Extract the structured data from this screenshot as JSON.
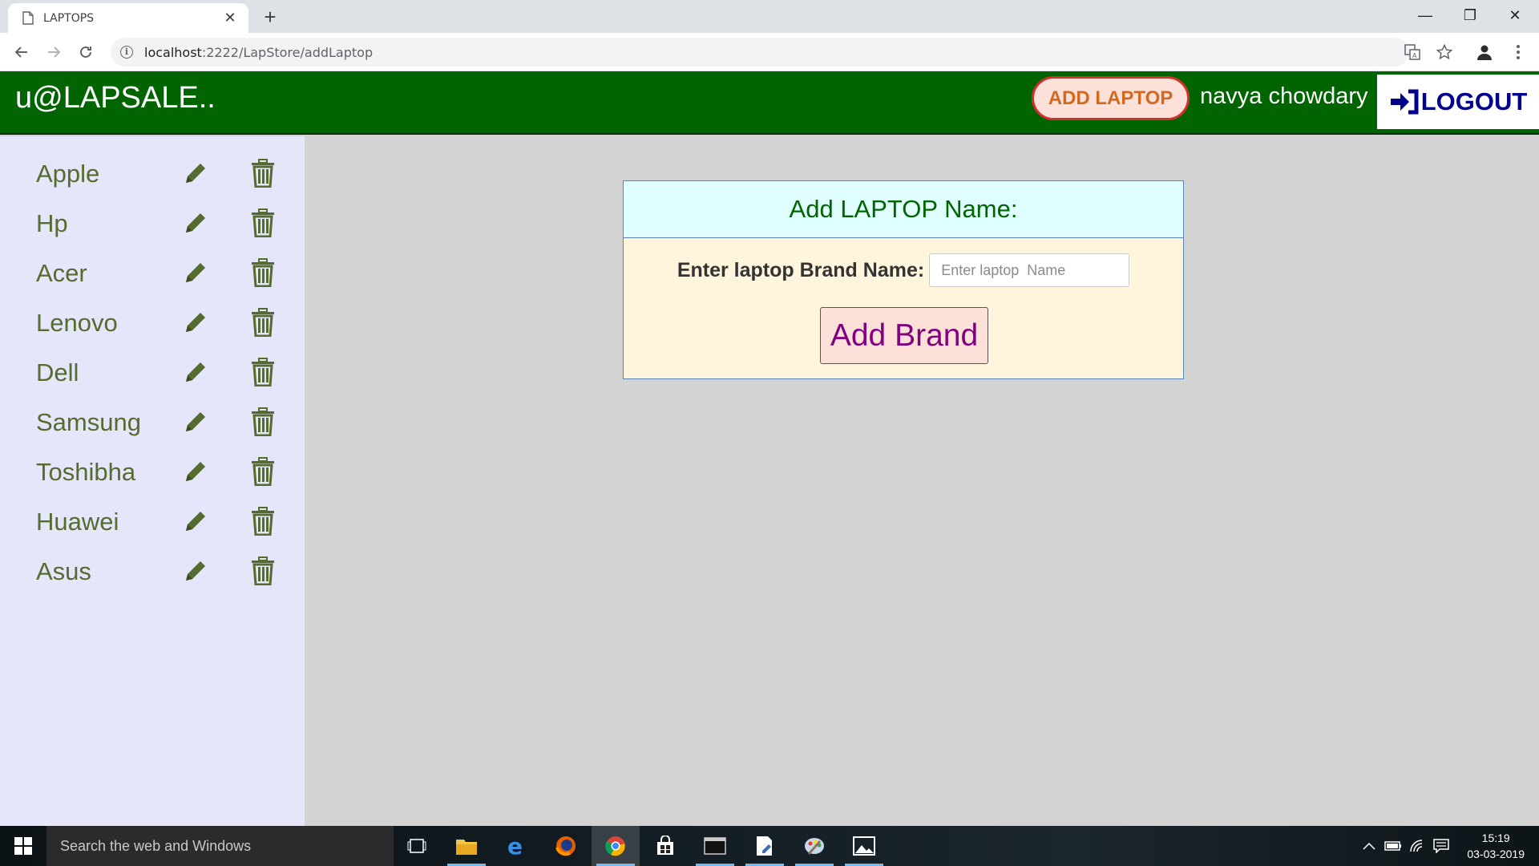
{
  "browser": {
    "tab_title": "LAPTOPS",
    "tab_close": "✕",
    "new_tab": "+",
    "url_host": "localhost",
    "url_rest": ":2222/LapStore/addLaptop",
    "window_controls": {
      "minimize": "—",
      "restore": "❐",
      "close": "✕"
    }
  },
  "header": {
    "brand": "u@LAPSALE..",
    "add_laptop_label": "ADD LAPTOP",
    "user_name": "navya chowdary",
    "logout_label": "LOGOUT"
  },
  "sidebar": {
    "items": [
      {
        "label": "Apple"
      },
      {
        "label": "Hp"
      },
      {
        "label": "Acer"
      },
      {
        "label": "Lenovo"
      },
      {
        "label": "Dell"
      },
      {
        "label": "Samsung"
      },
      {
        "label": "Toshibha"
      },
      {
        "label": "Huawei"
      },
      {
        "label": "Asus"
      }
    ]
  },
  "form": {
    "title": "Add LAPTOP Name:",
    "brand_label": "Enter laptop Brand Name:",
    "brand_placeholder": "Enter laptop  Name",
    "brand_value": "",
    "submit_label": "Add Brand"
  },
  "taskbar": {
    "search_placeholder": "Search the web and Windows",
    "time": "15:19",
    "date": "03-03-2019"
  },
  "colors": {
    "header_bg": "#006400",
    "sidebar_bg": "#e6e6fa",
    "sidebar_text": "#556b2f",
    "panel_head_bg": "#e0ffff",
    "panel_body_bg": "#fff5dc",
    "logout_text": "#00008b",
    "add_brand_text": "#800080"
  }
}
